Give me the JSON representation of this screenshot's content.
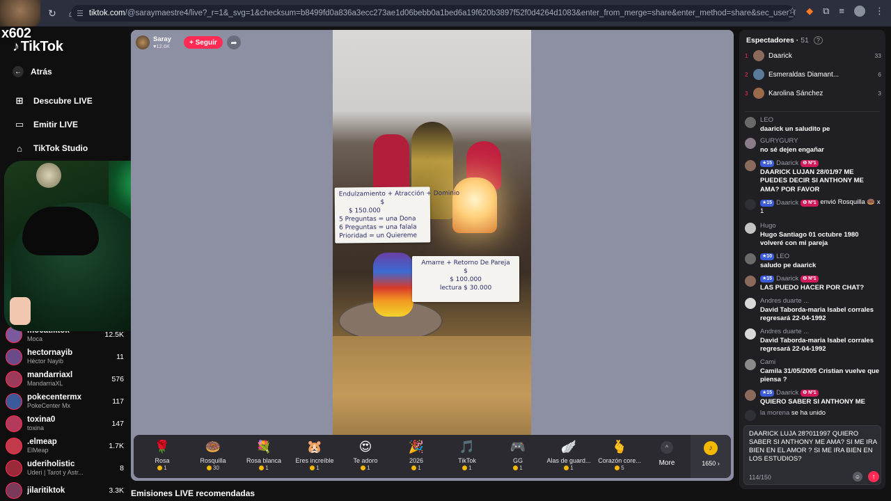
{
  "browser": {
    "url_host": "tiktok.com",
    "url_rest": "/@saraymaestre4/live?_r=1&_svg=1&checksum=b8499fd0a836a3ecc273ae1d06bebb0a1bed6a19f620b3897f52f0d4264d1083&enter_from_merge=share&enter_method=share&sec_user_id=MS4wLjABAAAAzrDx76Mka81fEXR_...",
    "back_icon": "←",
    "forward_icon": "→",
    "reload_icon": "↻",
    "home_icon": "⌂"
  },
  "overlay": {
    "badge": "x602"
  },
  "sidebar": {
    "logo": "TikTok",
    "back_label": "Atrás",
    "nav": [
      {
        "label": "Descubre LIVE",
        "icon": "live-grid-icon"
      },
      {
        "label": "Emitir LIVE",
        "icon": "camera-icon"
      },
      {
        "label": "TikTok Studio",
        "icon": "studio-icon"
      }
    ],
    "following": [
      {
        "username": "mocatiktok",
        "display": "Moca",
        "count": "12.5K",
        "color": "#7a5a9c"
      },
      {
        "username": "hectornayib",
        "display": "Héctor Nayib",
        "count": "11",
        "color": "#6a4b8a"
      },
      {
        "username": "mandarriaxl",
        "display": "MandarriaXL",
        "count": "576",
        "color": "#9c3a5a"
      },
      {
        "username": "pokecentermx",
        "display": "PokeCenter Mx",
        "count": "117",
        "color": "#3a5a9c"
      },
      {
        "username": "toxina0",
        "display": "toxina",
        "count": "147",
        "color": "#b33a5a"
      },
      {
        "username": ".elmeap",
        "display": "ElMeap",
        "count": "1.7K",
        "color": "#c23a4a"
      },
      {
        "username": "uderiholistic",
        "display": "Uderi | Tarot y Astr...",
        "count": "8",
        "color": "#9a2a3a"
      },
      {
        "username": "jilaritiktok",
        "display": "",
        "count": "3.3K",
        "color": "#7a3a5a"
      }
    ]
  },
  "stage": {
    "host_name": "Saray",
    "host_likes": "♥12.6K",
    "follow_label": "+ Seguir",
    "share_icon": "➦",
    "card1_lines": [
      "Endulzamiento + Atracción + Dominio",
      "$",
      "$ 150.000",
      "5 Preguntas = una Dona",
      "6 Preguntas = una falala",
      "Prioridad = un Quiereme"
    ],
    "card2_lines": [
      "Amarre + Retorno De Pareja",
      "$",
      "$ 100.000",
      "lectura $ 30.000"
    ]
  },
  "gifts": [
    {
      "name": "Rosa",
      "cost": "1",
      "icon": "🌹"
    },
    {
      "name": "Rosquilla",
      "cost": "30",
      "icon": "🍩"
    },
    {
      "name": "Rosa blanca",
      "cost": "1",
      "icon": "💐"
    },
    {
      "name": "Eres increíble",
      "cost": "1",
      "icon": "🐹"
    },
    {
      "name": "Te adoro",
      "cost": "1",
      "icon": "😍"
    },
    {
      "name": "2026",
      "cost": "1",
      "icon": "🎉"
    },
    {
      "name": "TikTok",
      "cost": "1",
      "icon": "🎵"
    },
    {
      "name": "GG",
      "cost": "1",
      "icon": "🎮"
    },
    {
      "name": "Alas de guard...",
      "cost": "1",
      "icon": "🪽"
    },
    {
      "name": "Corazón core...",
      "cost": "5",
      "icon": "🫰"
    }
  ],
  "gift_more": {
    "label": "More",
    "chevron": "^"
  },
  "recharge": {
    "amount": "1650 ›"
  },
  "recommended": "Emisiones LIVE recomendadas",
  "chat": {
    "viewers_title": "Espectadores · ",
    "viewers_count": "51",
    "viewers_help_icon": "?",
    "top_viewers": [
      {
        "rank": "1",
        "name": "Daarick",
        "score": "33",
        "color": "#8a6a5a"
      },
      {
        "rank": "2",
        "name": "Esmeraldas Diamant...",
        "score": "6",
        "color": "#5a7a9a"
      },
      {
        "rank": "3",
        "name": "Karolina Sánchez",
        "score": "3",
        "color": "#9a6a4a"
      }
    ],
    "messages": [
      {
        "user": "LEO",
        "text": "daarick un saludito pe",
        "lv": "",
        "n1": false,
        "color": "#6a6a6a"
      },
      {
        "user": "GURYGURY",
        "text": "no sé dejen engañar",
        "lv": "",
        "n1": false,
        "color": "#8a7a8a"
      },
      {
        "user": "Daarick",
        "text": "DAARICK LUJAN 28/01/97 ME PUEDES DECIR SI ANTHONY ME AMA? POR FAVOR",
        "lv": "15",
        "n1": true,
        "color": "#8a6a5a"
      },
      {
        "user": "Daarick",
        "text": "envió Rosquilla 🍩 x 1",
        "lv": "15",
        "n1": true,
        "color": "#2f2f36"
      },
      {
        "user": "Hugo",
        "text": "Hugo Santiago 01 octubre 1980 volveré con mi pareja",
        "lv": "",
        "n1": false,
        "color": "#c4c4c4"
      },
      {
        "user": "LEO",
        "text": "saludo pe daarick",
        "lv": "10",
        "n1": false,
        "color": "#6a6a6a"
      },
      {
        "user": "Daarick",
        "text": "LAS PUEDO HACER POR CHAT?",
        "lv": "15",
        "n1": true,
        "color": "#8a6a5a"
      },
      {
        "user": "Andres duarte ...",
        "text": "David Taborda-maria Isabel corrales regresará 22-04-1992",
        "lv": "",
        "n1": false,
        "color": "#d8d8d8"
      },
      {
        "user": "Andres duarte ...",
        "text": "David Taborda-maria Isabel corrales regresará 22-04-1992",
        "lv": "",
        "n1": false,
        "color": "#d8d8d8"
      },
      {
        "user": "Cami",
        "text": "Camila 31/05/2005 Cristian vuelve que piensa ?",
        "lv": "",
        "n1": false,
        "color": "#8a8a8a"
      },
      {
        "user": "Daarick",
        "text": "QUIERO SABER SI ANTHONY ME",
        "lv": "15",
        "n1": true,
        "color": "#8a6a5a"
      },
      {
        "user": "la morena",
        "text": "se ha unido",
        "lv": "",
        "n1": false,
        "color": "#2f2f36"
      }
    ],
    "input_text": "DAARICK LUJA 28?011997 QUIERO SABER SI ANTHONY ME AMA? SI ME IRA BIEN EN EL AMOR ? SI ME IRA BIEN EN LOS ESTUDIOS?",
    "char_counter": "114/150",
    "send_icon": "↑",
    "emoji_icon": "☺"
  }
}
